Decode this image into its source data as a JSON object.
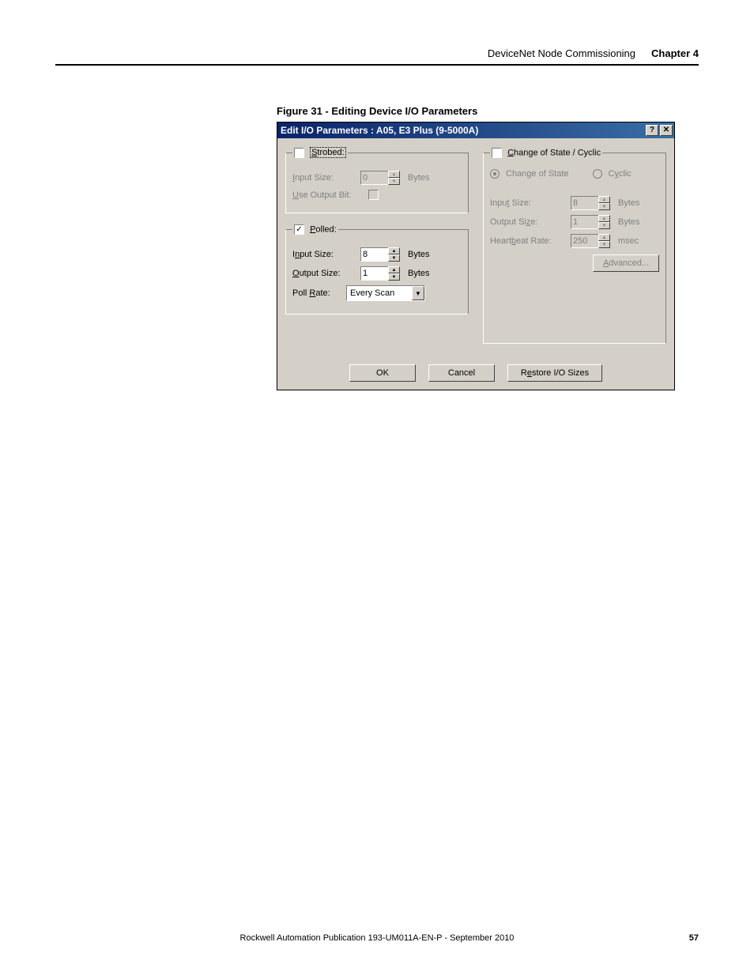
{
  "header": {
    "breadcrumb": "DeviceNet Node Commissioning",
    "chapter": "Chapter 4"
  },
  "figure": {
    "caption": "Figure 31 - Editing Device I/O Parameters"
  },
  "dialog": {
    "title": "Edit I/O Parameters : A05, E3 Plus (9-5000A)"
  },
  "strobed": {
    "legend_prefix": "S",
    "legend_rest": "trobed:",
    "input_size_label_prefix": "I",
    "input_size_label_rest": "nput Size:",
    "input_size_value": "0",
    "input_size_unit": "Bytes",
    "use_output_label_prefix": "U",
    "use_output_label_rest": "se Output Bit:"
  },
  "polled": {
    "legend_prefix": "P",
    "legend_rest": "olled:",
    "input_size_label_prefix_pre": "I",
    "input_size_label_prefix_u": "n",
    "input_size_label_rest": "put Size:",
    "input_size_value": "8",
    "input_size_unit": "Bytes",
    "output_size_label_prefix": "O",
    "output_size_label_rest": "utput Size:",
    "output_size_value": "1",
    "output_size_unit": "Bytes",
    "poll_rate_label_pre": "Poll ",
    "poll_rate_label_u": "R",
    "poll_rate_label_rest": "ate:",
    "poll_rate_value": "Every Scan"
  },
  "cos": {
    "legend_prefix": "C",
    "legend_rest": "hange of State / Cyclic",
    "cos_label": "Change of State",
    "cyclic_label_pre": "C",
    "cyclic_label_u": "y",
    "cyclic_label_rest": "clic",
    "input_size_label_pre": "Inpu",
    "input_size_label_u": "t",
    "input_size_label_rest": " Size:",
    "input_size_value": "8",
    "input_size_unit": "Bytes",
    "output_size_label_pre": "Output Si",
    "output_size_label_u": "z",
    "output_size_label_rest": "e:",
    "output_size_value": "1",
    "output_size_unit": "Bytes",
    "heartbeat_label_pre": "Heart",
    "heartbeat_label_u": "b",
    "heartbeat_label_rest": "eat Rate:",
    "heartbeat_value": "250",
    "heartbeat_unit": "msec",
    "advanced_label_u": "A",
    "advanced_label_rest": "dvanced..."
  },
  "buttons": {
    "ok": "OK",
    "cancel": "Cancel",
    "restore_pre": "R",
    "restore_u": "e",
    "restore_rest": "store I/O Sizes"
  },
  "footer": {
    "publication": "Rockwell Automation Publication 193-UM011A-EN-P - September 2010",
    "page": "57"
  }
}
